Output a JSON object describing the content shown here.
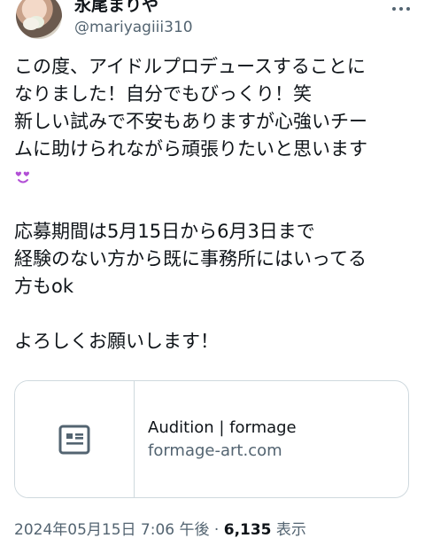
{
  "author": {
    "display_name": "永尾まりや",
    "handle": "@mariyagiii310"
  },
  "tweet": {
    "paragraphs": [
      [
        "この度、アイドルプロデュースすることに",
        "なりました！自分でもびっくり！笑",
        "新しい試みで不安もありますが心強いチー",
        "ムに助けられながら頑張りたいと思います"
      ],
      [
        "応募期間は5月15日から6月3日まで",
        "経験のない方から既に事務所にはいってる",
        "方もok"
      ],
      [
        "よろしくお願いします！"
      ]
    ],
    "emoji": "smiling-face-with-heart-eyes-emoji"
  },
  "link_card": {
    "title": "Audition | formage",
    "domain": "formage-art.com",
    "icon": "article-icon"
  },
  "meta": {
    "timestamp": "2024年05月15日 7:06 午後",
    "separator": "·",
    "views_count": "6,135",
    "views_label": "表示"
  },
  "colors": {
    "text": "#0f1419",
    "secondary": "#536471",
    "border": "#cfd9de",
    "emoji": "#b24fd6"
  }
}
